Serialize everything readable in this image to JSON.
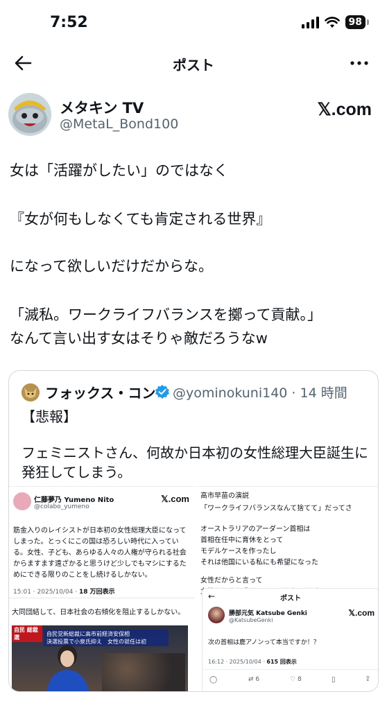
{
  "status_bar": {
    "time": "7:52",
    "battery": "98"
  },
  "nav": {
    "title": "ポスト"
  },
  "author": {
    "name": "メタキン TV",
    "handle": "@MetaL_Bond100",
    "watermark": "𝕏.com"
  },
  "post": {
    "lines": [
      "女は「活躍がしたい」のではなく",
      "『女が何もしなくても肯定される世界』",
      "になって欲しいだけだからな。",
      "「滅私。ワークライフバランスを擲って貢献。」",
      "なんて言い出す女はそりゃ敵だろうなw"
    ]
  },
  "quote": {
    "name": "フォックス・コン",
    "meta": "@yominokuni140 · 14 時間",
    "lines": [
      "【悲報】",
      "フェミニストさん、何故か日本初の女性総理大臣誕生に",
      "発狂してしまう。"
    ],
    "left_image": {
      "name": "仁藤夢乃 Yumeno Nito",
      "handle": "@colabo_yumeno",
      "xcom": "𝕏.com",
      "body": [
        "筋金入りのレイシストが日本初の女性総理大臣になって",
        "しまった。とっくにこの国は恐ろしい時代に入ってい",
        "る。女性、子ども、あらゆる人々の人権が守られる社会",
        "からますます遠ざかると思うけど少しでもマシにするた",
        "めにできる限りのことをし続けるしかない。"
      ],
      "timestamp": "15:01 · 2025/10/04 · ",
      "views": "18 万回表示",
      "footer": "大同団結して、日本社会の右傾化を阻止するしかない。",
      "news_tag": "自民 総裁選",
      "news_banner": [
        "自民党新総裁に高市前経済安保相",
        "決選投票で小泉氏抑え　女性の就任は初"
      ]
    },
    "right_image": {
      "lines": [
        "高市早苗の演説",
        "「ワークライフバランスなんて捨てて」だってさ",
        "",
        "オーストラリアのアーダーン首相は",
        "首相在任中に育休をとって",
        "モデルケースを作ったし",
        "それは他国にいる私にも希望になった",
        "",
        "女性だからと言って",
        "女性らしさを求めることはしないけど"
      ],
      "inner": {
        "title": "ポスト",
        "name": "勝部元気 Katsube Genki",
        "handle": "@KatsubeGenki",
        "xcom": "𝕏.com",
        "text": "次の首相は鹿アノンって本当ですか！？",
        "timestamp": "16:12 · 2025/10/04 · ",
        "views": "615 回表示",
        "retweets": "6",
        "likes": "8"
      }
    }
  },
  "colors": {
    "text": "#0f1419",
    "secondary": "#536471",
    "verified": "#1d9bf0",
    "border": "#cfd9de"
  }
}
